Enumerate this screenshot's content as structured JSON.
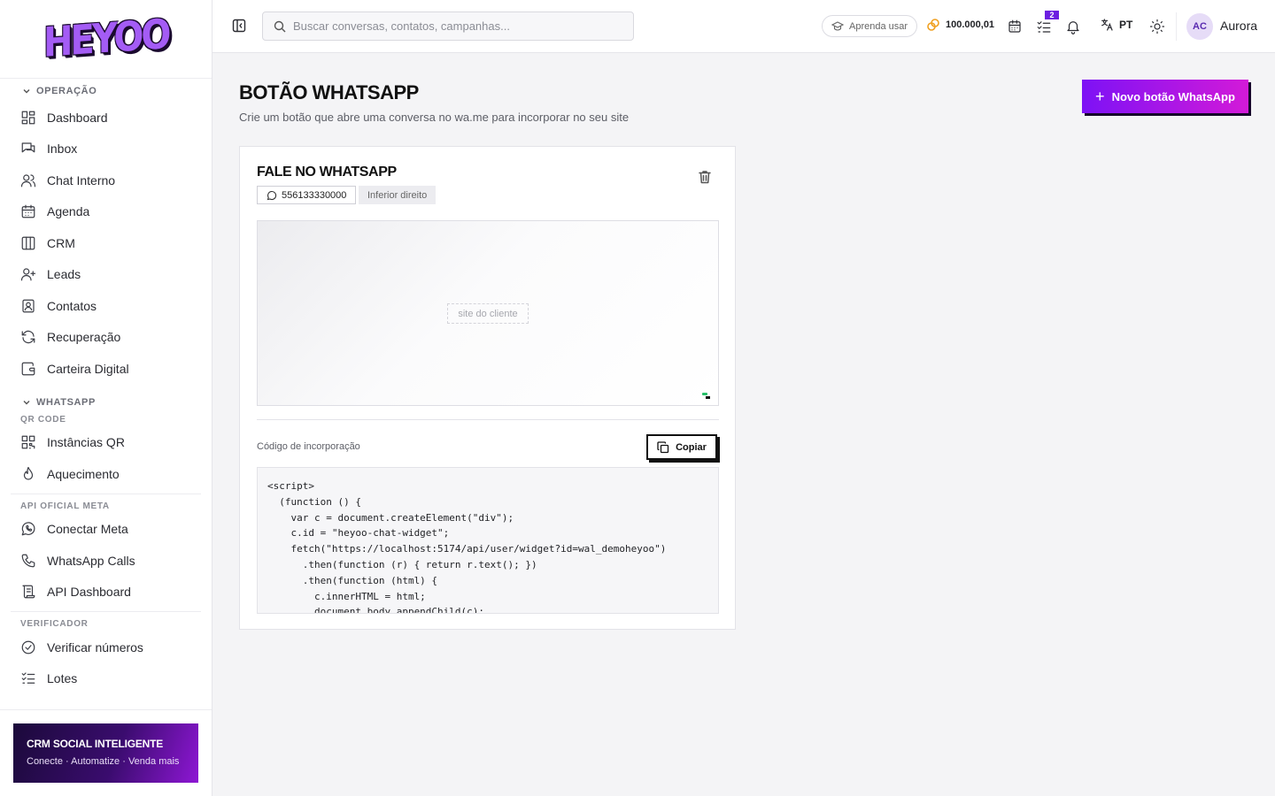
{
  "brand": {
    "logo_text": "HEYOO"
  },
  "sidebar": {
    "sections": [
      {
        "title": "OPERAÇÃO",
        "items": [
          "Dashboard",
          "Inbox",
          "Chat Interno",
          "Agenda",
          "CRM",
          "Leads",
          "Contatos",
          "Recuperação",
          "Carteira Digital"
        ]
      },
      {
        "title": "WHATSAPP",
        "subsections": [
          {
            "title": "QR CODE",
            "items": [
              "Instâncias QR",
              "Aquecimento"
            ]
          },
          {
            "title": "API OFICIAL META",
            "items": [
              "Conectar Meta",
              "WhatsApp Calls",
              "API Dashboard"
            ]
          },
          {
            "title": "VERIFICADOR",
            "items": [
              "Verificar números",
              "Lotes"
            ]
          }
        ]
      }
    ],
    "promo": {
      "title": "CRM SOCIAL INTELIGENTE",
      "subtitle": "Conecte · Automatize · Venda mais"
    }
  },
  "topbar": {
    "search_placeholder": "Buscar conversas, contatos, campanhas...",
    "learn_label": "Aprenda usar",
    "credits": "100.000,01",
    "tasks_badge": "2",
    "language": "PT",
    "avatar_initials": "AC",
    "user_name": "Aurora"
  },
  "page": {
    "title": "BOTÃO WHATSAPP",
    "subtitle": "Crie um botão que abre uma conversa no wa.me para incorporar no seu site",
    "new_button_label": "Novo botão WhatsApp"
  },
  "card": {
    "title": "FALE NO WHATSAPP",
    "phone": "556133330000",
    "position": "Inferior direito",
    "preview_label": "site do cliente",
    "embed_label": "Código de incorporação",
    "copy_label": "Copiar",
    "code": "<script>\n  (function () {\n    var c = document.createElement(\"div\");\n    c.id = \"heyoo-chat-widget\";\n    fetch(\"https://localhost:5174/api/user/widget?id=wal_demoheyoo\")\n      .then(function (r) { return r.text(); })\n      .then(function (html) {\n        c.innerHTML = html;\n        document.body.appendChild(c);"
  },
  "colors": {
    "accent": "#7d12f5",
    "accent_end": "#d31ad8",
    "whatsapp_green": "#27c06a"
  }
}
